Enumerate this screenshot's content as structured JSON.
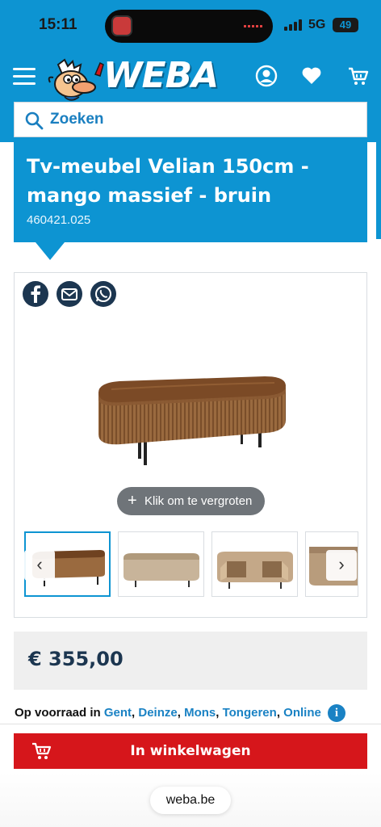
{
  "status_bar": {
    "time": "15:11",
    "network": "5G",
    "battery": "49"
  },
  "header": {
    "logo": "WEBA",
    "icons": [
      "menu-icon",
      "account-icon",
      "heart-icon",
      "cart-icon"
    ]
  },
  "search": {
    "placeholder": "Zoeken"
  },
  "product": {
    "title": "Tv-meubel Velian 150cm - mango massief - bruin",
    "sku": "460421.025",
    "price": "€ 355,00"
  },
  "gallery": {
    "zoom_label": "Klik om te vergroten",
    "share": [
      "facebook-icon",
      "email-icon",
      "whatsapp-icon"
    ],
    "thumbnail_count": 4,
    "active_thumbnail": 1
  },
  "stock": {
    "prefix": "Op voorraad in",
    "stores": [
      "Gent",
      "Deinze",
      "Mons",
      "Tongeren",
      "Online"
    ]
  },
  "cart_button": {
    "label": "In winkelwagen"
  },
  "browser": {
    "url": "weba.be"
  },
  "colors": {
    "brand_blue": "#0d94d2",
    "cart_red": "#d6161b",
    "navy": "#1c3650"
  }
}
